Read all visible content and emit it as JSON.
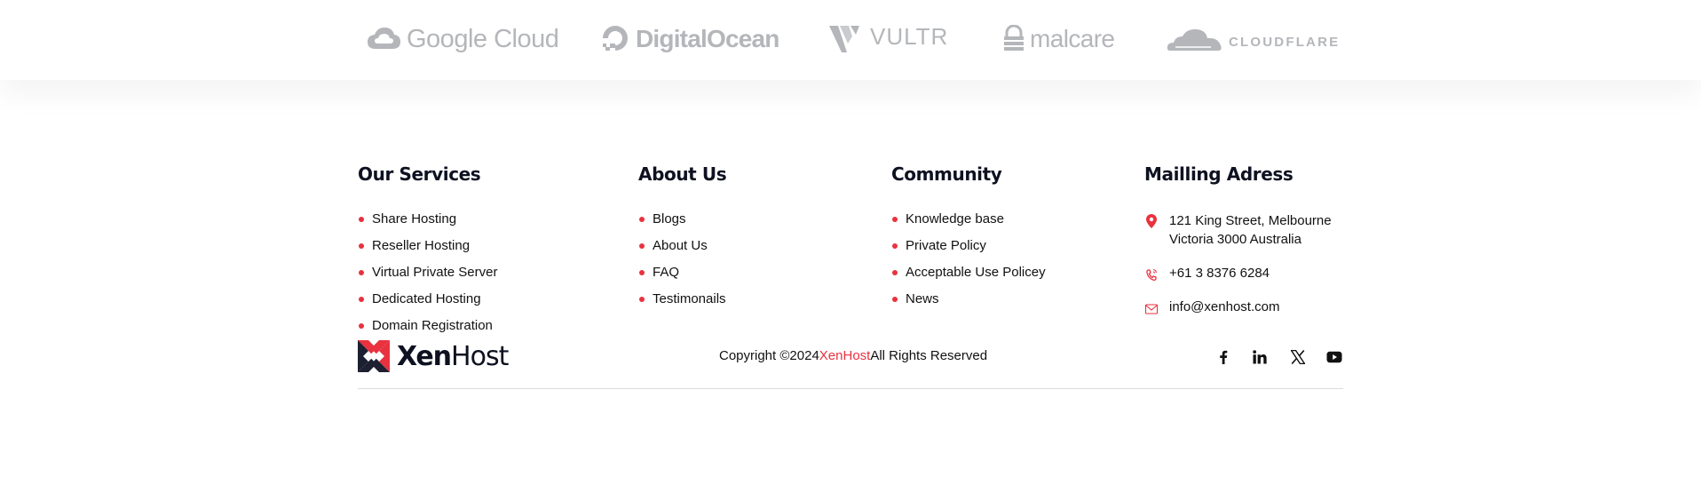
{
  "partners": [
    {
      "name": "Google Cloud",
      "icon": "google-cloud-logo-icon"
    },
    {
      "name": "DigitalOcean",
      "icon": "digitalocean-logo-icon"
    },
    {
      "name": "VULTR",
      "icon": "vultr-logo-icon"
    },
    {
      "name": "malcare",
      "icon": "malcare-logo-icon"
    },
    {
      "name": "CLOUDFLARE",
      "icon": "cloudflare-logo-icon"
    }
  ],
  "services": {
    "title": "Our Services",
    "items": [
      "Share Hosting",
      "Reseller Hosting",
      "Virtual Private Server",
      "Dedicated Hosting",
      "Domain Registration"
    ]
  },
  "about": {
    "title": "About Us",
    "items": [
      "Blogs",
      "About Us",
      "FAQ",
      "Testimonails"
    ]
  },
  "community": {
    "title": "Community",
    "items": [
      "Knowledge base",
      "Private Policy",
      "Acceptable Use Policey",
      "News"
    ]
  },
  "mailing": {
    "title": "Mailling Adress",
    "address_line1": "121 King Street, Melbourne",
    "address_line2": "Victoria 3000 Australia",
    "phone": "+61 3 8376 6284",
    "email": "info@xenhost.com"
  },
  "brand": {
    "name_bold": "Xen",
    "name_light": "Host"
  },
  "copyright": {
    "prefix": "Copyright ©2024",
    "brand": "XenHost",
    "suffix": "All Rights Reserved"
  },
  "social": [
    "facebook-icon",
    "linkedin-icon",
    "x-icon",
    "youtube-icon"
  ],
  "colors": {
    "accent": "#e8323f",
    "heading": "#0d1120",
    "logo_gray": "#b4b6ba"
  }
}
